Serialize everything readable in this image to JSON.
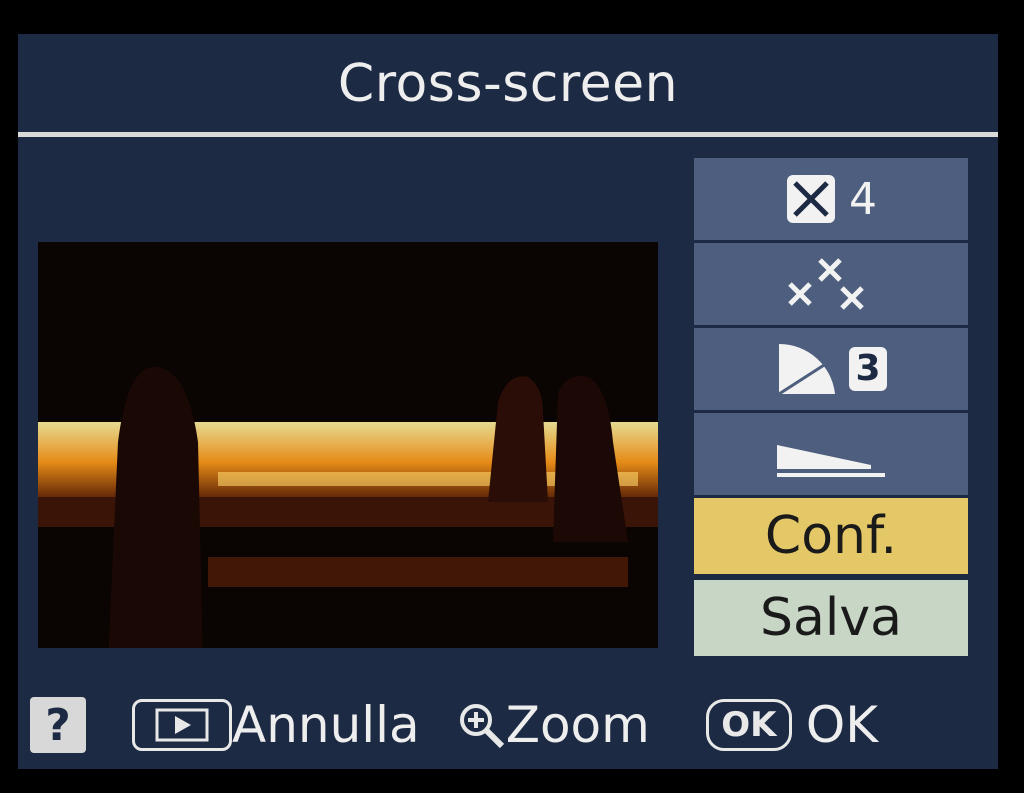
{
  "header": {
    "title": "Cross-screen"
  },
  "menu": {
    "points": {
      "icon": "cross-box-icon",
      "value": "4"
    },
    "amount": {
      "icon": "star-sparkle-icon"
    },
    "angle": {
      "icon": "angle-icon",
      "value": "3"
    },
    "length": {
      "icon": "length-icon"
    },
    "confirm_label": "Conf.",
    "save_label": "Salva"
  },
  "footer": {
    "help_label": "?",
    "cancel_label": "Annulla",
    "zoom_label": "Zoom",
    "ok_badge": "OK",
    "ok_label": "OK"
  },
  "colors": {
    "background": "#1d2a44",
    "menu_item": "#4d5e7e",
    "confirm": "#e4c868",
    "save": "#c8d6c6"
  }
}
